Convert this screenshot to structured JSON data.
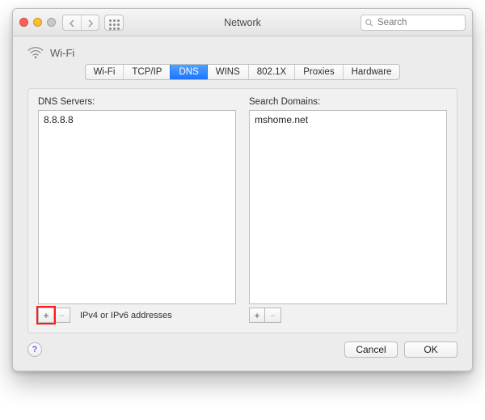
{
  "window": {
    "title": "Network"
  },
  "toolbar": {
    "search_placeholder": "Search"
  },
  "service": {
    "name": "Wi-Fi"
  },
  "tabs": [
    {
      "label": "Wi-Fi",
      "selected": false
    },
    {
      "label": "TCP/IP",
      "selected": false
    },
    {
      "label": "DNS",
      "selected": true
    },
    {
      "label": "WINS",
      "selected": false
    },
    {
      "label": "802.1X",
      "selected": false
    },
    {
      "label": "Proxies",
      "selected": false
    },
    {
      "label": "Hardware",
      "selected": false
    }
  ],
  "dns": {
    "servers_label": "DNS Servers:",
    "servers": [
      "8.8.8.8"
    ],
    "domains_label": "Search Domains:",
    "domains": [
      "mshome.net"
    ],
    "hint": "IPv4 or IPv6 addresses",
    "add_glyph": "+",
    "remove_glyph": "−"
  },
  "buttons": {
    "cancel": "Cancel",
    "ok": "OK",
    "help": "?"
  }
}
